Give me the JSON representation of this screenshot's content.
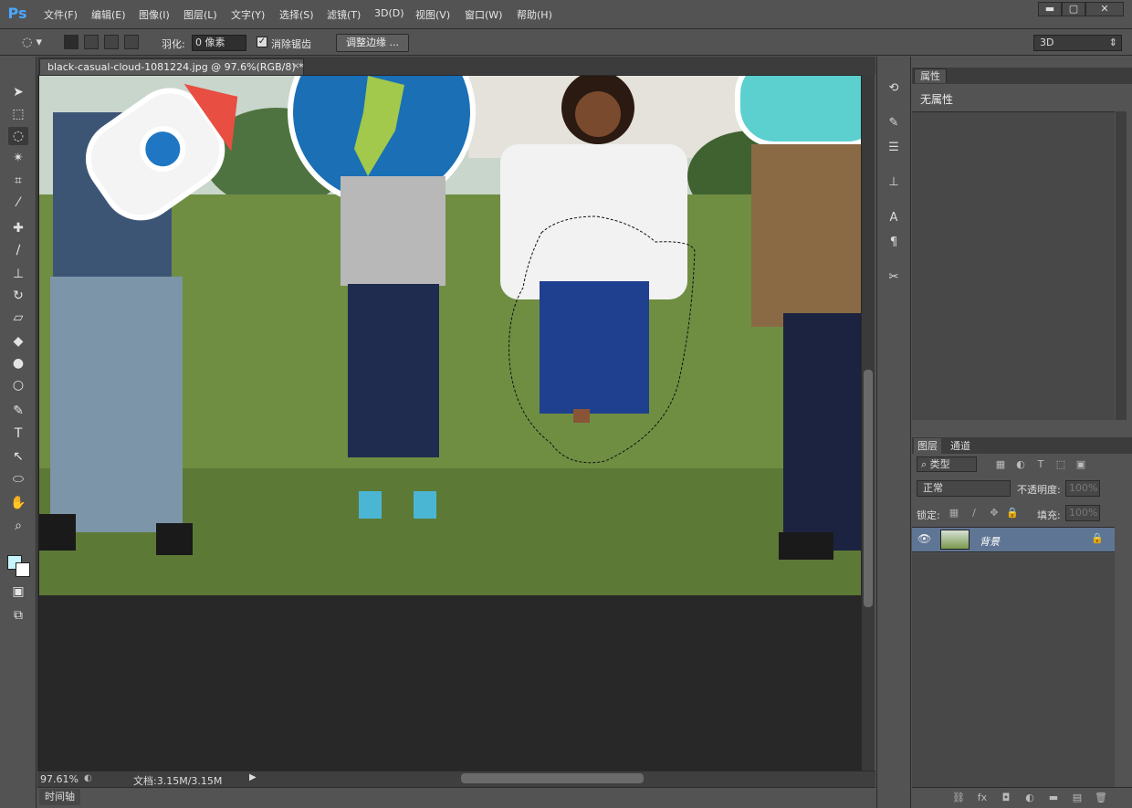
{
  "app": {
    "logo": "Ps"
  },
  "menu": [
    "文件(F)",
    "编辑(E)",
    "图像(I)",
    "图层(L)",
    "文字(Y)",
    "选择(S)",
    "滤镜(T)",
    "3D(D)",
    "视图(V)",
    "窗口(W)",
    "帮助(H)"
  ],
  "window_controls": {
    "minimize": "▬",
    "maximize": "▢",
    "close": "✕"
  },
  "options": {
    "feather_label": "羽化:",
    "feather_value": "0 像素",
    "antialias_label": "消除锯齿",
    "antialias_checked": "✓",
    "refine_edge": "调整边缘 ...",
    "workspace": "3D"
  },
  "document": {
    "tab_title": "black-casual-cloud-1081224.jpg @ 97.6%(RGB/8) *",
    "close": "×",
    "zoom": "97.61%",
    "doc_size": "文档:3.15M/3.15M"
  },
  "timeline": {
    "label": "时间轴"
  },
  "tools": [
    {
      "name": "move-tool",
      "glyph": "➤"
    },
    {
      "name": "marquee-tool",
      "glyph": "⬚"
    },
    {
      "name": "lasso-tool",
      "glyph": "◌"
    },
    {
      "name": "magic-wand-tool",
      "glyph": "✴"
    },
    {
      "name": "crop-tool",
      "glyph": "⌗"
    },
    {
      "name": "eyedropper-tool",
      "glyph": "⁄"
    },
    {
      "name": "healing-tool",
      "glyph": "✚"
    },
    {
      "name": "brush-tool",
      "glyph": "∕"
    },
    {
      "name": "stamp-tool",
      "glyph": "⊥"
    },
    {
      "name": "history-brush-tool",
      "glyph": "↻"
    },
    {
      "name": "eraser-tool",
      "glyph": "▱"
    },
    {
      "name": "paint-bucket-tool",
      "glyph": "◆"
    },
    {
      "name": "blur-tool",
      "glyph": "●"
    },
    {
      "name": "dodge-tool",
      "glyph": "○"
    },
    {
      "name": "pen-tool",
      "glyph": "✎"
    },
    {
      "name": "type-tool",
      "glyph": "T"
    },
    {
      "name": "path-select-tool",
      "glyph": "↖"
    },
    {
      "name": "shape-tool",
      "glyph": "⬭"
    },
    {
      "name": "hand-tool",
      "glyph": "✋"
    },
    {
      "name": "zoom-tool",
      "glyph": "⌕"
    }
  ],
  "properties": {
    "tab": "属性",
    "empty": "无属性"
  },
  "layers": {
    "tabs": [
      "图层",
      "通道"
    ],
    "filter": "类型",
    "blend_mode": "正常",
    "opacity_label": "不透明度:",
    "opacity_value": "100%",
    "lock_label": "锁定:",
    "fill_label": "填充:",
    "fill_value": "100%",
    "items": [
      {
        "name": "背景",
        "visible": true,
        "locked": true
      }
    ]
  },
  "colors": {
    "foreground": "#c8f4ff",
    "background": "#ffffff",
    "selected_layer": "#5f7594"
  }
}
